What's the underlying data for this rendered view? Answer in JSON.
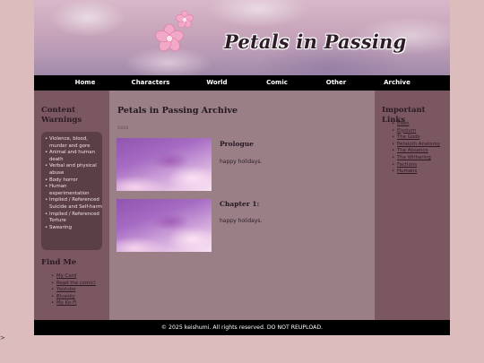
{
  "site": {
    "title": "Petals in Passing"
  },
  "nav": {
    "items": [
      "Home",
      "Characters",
      "World",
      "Comic",
      "Other",
      "Archive"
    ]
  },
  "left": {
    "content_warnings_heading": "Content Warnings",
    "warnings": [
      "Violence, blood, murder and gore",
      "Animal and human death",
      "Verbal and physical abuse",
      "Body horror",
      "Human experimentation",
      "Implied / Referenced Suicide and Self-harm",
      "Implied / Referenced Torture",
      "Swearing"
    ],
    "find_me_heading": "Find Me",
    "find_me_links": [
      "My Card",
      "Read the comic!",
      "Youtube",
      "Bluesky",
      "My Ko-Fi"
    ]
  },
  "main": {
    "title": "Petals in Passing Archive",
    "subtitle": "ssss",
    "entries": [
      {
        "title": "Prologue",
        "text": "happy holidays."
      },
      {
        "title": "Chapter 1:",
        "text": "happy holidays."
      }
    ]
  },
  "right": {
    "heading": "Important Links",
    "links": [
      "Eden",
      "Elysium",
      "The Gods",
      "Petaloth Anatomy",
      "The Absence",
      "The Withering",
      "Factions",
      "Humans"
    ]
  },
  "footer": {
    "text": "© 2025 keishumi. All rights reserved. DO NOT REUPLOAD."
  },
  "stray_glyph": ">"
}
